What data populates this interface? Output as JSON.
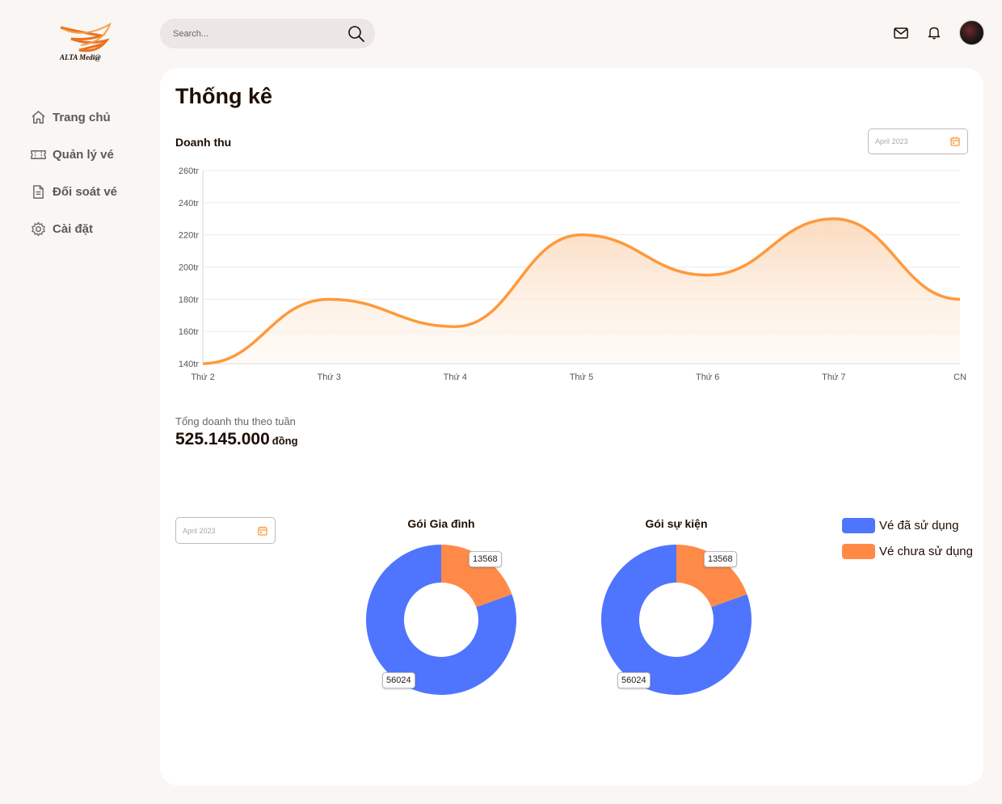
{
  "brand": {
    "logo_text": "ALTA Medi@"
  },
  "sidebar": {
    "items": [
      {
        "label": "Trang chủ",
        "icon": "home-icon"
      },
      {
        "label": "Quản lý vé",
        "icon": "ticket-icon"
      },
      {
        "label": "Đối soát vé",
        "icon": "document-icon"
      },
      {
        "label": "Cài đặt",
        "icon": "gear-icon"
      }
    ]
  },
  "topbar": {
    "search_placeholder": "Search...",
    "icons": [
      "mail-icon",
      "bell-icon",
      "avatar"
    ]
  },
  "page": {
    "title": "Thống kê"
  },
  "revenue": {
    "label": "Doanh thu",
    "date_picker": "April 2023",
    "total_label": "Tổng doanh thu theo tuần",
    "total_value": "525.145.000",
    "total_unit": "đồng"
  },
  "packages": {
    "date_picker": "April 2023",
    "legend": [
      {
        "label": "Vé đã sử dụng",
        "color": "#4f75ff"
      },
      {
        "label": "Vé chưa sử dụng",
        "color": "#ff8a48"
      }
    ]
  },
  "colors": {
    "accent": "#ff993c",
    "used": "#4f75ff",
    "unused": "#ff8a48"
  },
  "chart_data": [
    {
      "type": "area",
      "title": "Doanh thu",
      "categories": [
        "Thứ 2",
        "Thứ 3",
        "Thứ 4",
        "Thứ 5",
        "Thứ 6",
        "Thứ 7",
        "CN"
      ],
      "values": [
        140,
        180,
        163,
        220,
        195,
        230,
        180
      ],
      "ytick_labels": [
        "140tr",
        "160tr",
        "180tr",
        "200tr",
        "220tr",
        "240tr",
        "260tr"
      ],
      "ylim": [
        140,
        260
      ],
      "grid": true
    },
    {
      "type": "pie",
      "title": "Gói Gia đình",
      "labels": [
        "Vé đã sử dụng",
        "Vé chưa sử dụng"
      ],
      "values": [
        56024,
        13568
      ]
    },
    {
      "type": "pie",
      "title": "Gói sự kiện",
      "labels": [
        "Vé đã sử dụng",
        "Vé chưa sử dụng"
      ],
      "values": [
        56024,
        13568
      ]
    }
  ]
}
